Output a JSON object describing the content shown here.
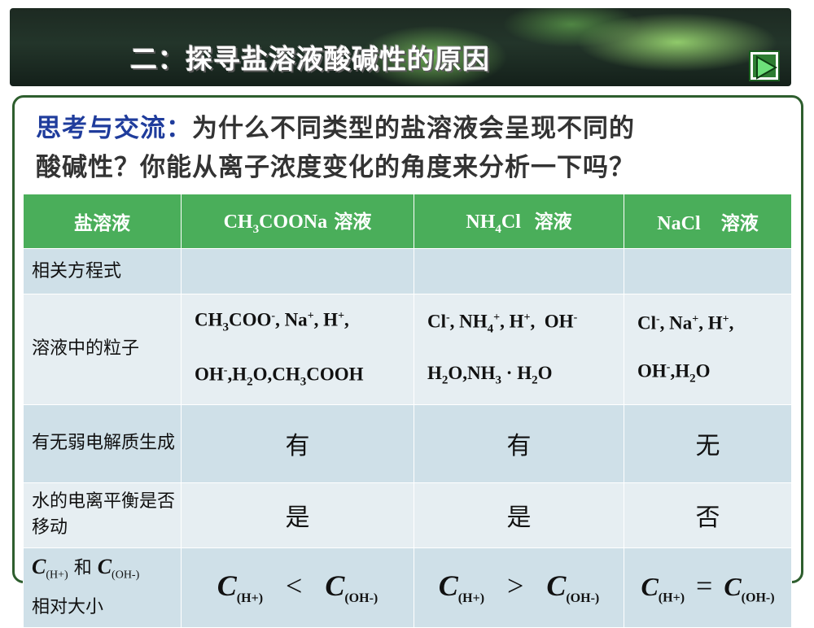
{
  "banner": {
    "title": "二：探寻盐溶液酸碱性的原因"
  },
  "question": {
    "lead": "思考与交流：",
    "line1_rest": "为什么不同类型的盐溶液会呈现不同的",
    "line2": "酸碱性？你能从离子浓度变化的角度来分析一下吗？"
  },
  "table": {
    "header": {
      "col0": "盐溶液",
      "col1_formula_a": "CH",
      "col1_sub": "3",
      "col1_formula_b": "COONa",
      "col1_suffix": "溶液",
      "col2_formula_a": "NH",
      "col2_sub": "4",
      "col2_formula_b": "Cl",
      "col2_suffix": "溶液",
      "col3_formula": "NaCl",
      "col3_suffix": "溶液"
    },
    "row_equation": {
      "label": "相关方程式"
    },
    "row_particles": {
      "label": "溶液中的粒子"
    },
    "row_weak": {
      "label": "有无弱电解质生成",
      "v1": "有",
      "v2": "有",
      "v3": "无"
    },
    "row_water": {
      "label": "水的电离平衡是否移动",
      "v1": "是",
      "v2": "是",
      "v3": "否"
    },
    "row_compare": {
      "label_suffix": "相对大小",
      "and": "和",
      "c": "C",
      "h": "(H+)",
      "oh": "(OH-)",
      "op1": "<",
      "op2": ">",
      "op3": "="
    }
  },
  "colors": {
    "header": "#4aae5a",
    "row_a": "#cfe0e8",
    "row_b": "#e6eef2",
    "lead": "#1f3c9c",
    "frame": "#2e5e2e"
  }
}
